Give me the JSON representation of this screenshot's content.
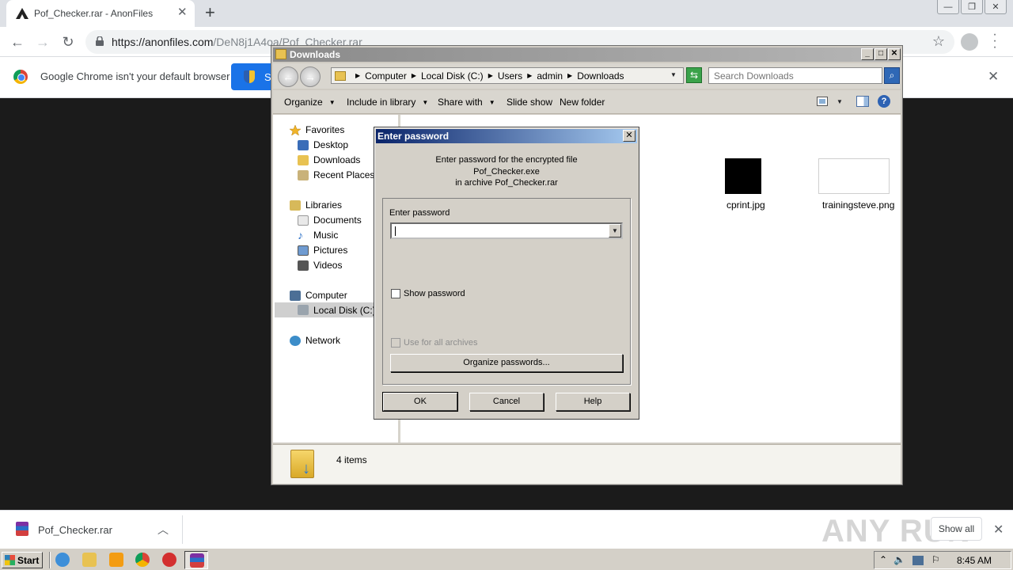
{
  "browser": {
    "tab_title": "Pof_Checker.rar - AnonFiles",
    "new_tab_glyph": "+",
    "url_host": "https://anonfiles.com",
    "url_path": "/DeN8j1A4oa/Pof_Checker.rar",
    "infobar_message": "Google Chrome isn't your default browser",
    "infobar_button_label": "S"
  },
  "explorer": {
    "title": "Downloads",
    "breadcrumbs": [
      "Computer",
      "Local Disk (C:)",
      "Users",
      "admin",
      "Downloads"
    ],
    "search_placeholder": "Search Downloads",
    "commands": {
      "organize": "Organize",
      "include_in_library": "Include in library",
      "share_with": "Share with",
      "slide_show": "Slide show",
      "new_folder": "New folder"
    },
    "nav": {
      "favorites": "Favorites",
      "desktop": "Desktop",
      "downloads": "Downloads",
      "recent_places": "Recent Places",
      "libraries": "Libraries",
      "documents": "Documents",
      "music": "Music",
      "pictures": "Pictures",
      "videos": "Videos",
      "computer": "Computer",
      "local_disk": "Local Disk (C:)",
      "network": "Network"
    },
    "files": [
      {
        "name": "cprint.jpg"
      },
      {
        "name": "trainingsteve.png"
      }
    ],
    "status_count": "4 items"
  },
  "dialog": {
    "title": "Enter password",
    "message_line1": "Enter password for the encrypted file",
    "message_line2": "Pof_Checker.exe",
    "message_line3": "in archive Pof_Checker.rar",
    "field_label": "Enter password",
    "password_value": "",
    "show_password_label": "Show password",
    "use_for_all_label": "Use for all archives",
    "organize_button": "Organize passwords...",
    "ok_button": "OK",
    "cancel_button": "Cancel",
    "help_button": "Help"
  },
  "shelf": {
    "download_name": "Pof_Checker.rar",
    "show_all_label": "Show all",
    "watermark": "ANY RUN"
  },
  "taskbar": {
    "start_label": "Start",
    "clock": "8:45 AM"
  },
  "colors": {
    "dialog_title_start": "#0a246a",
    "dialog_title_end": "#a6caf0",
    "chrome_blue": "#1a73e8",
    "page_background": "#1b1b1b"
  }
}
